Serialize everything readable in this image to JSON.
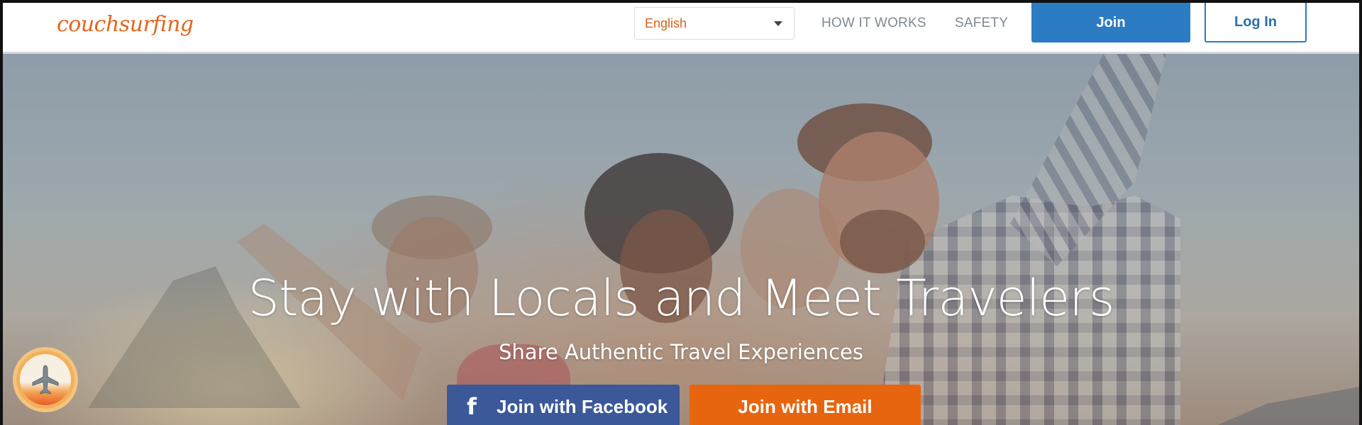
{
  "header": {
    "logo_text": "couchsurfing",
    "language": {
      "selected": "English"
    },
    "nav": [
      {
        "label": "HOW IT WORKS"
      },
      {
        "label": "SAFETY"
      }
    ],
    "join_label": "Join",
    "login_label": "Log In"
  },
  "hero": {
    "headline": "Stay with Locals and Meet Travelers",
    "subheadline": "Share Authentic Travel Experiences",
    "facebook_button": {
      "icon": "facebook-icon",
      "icon_glyph": "f",
      "label": "Join with Facebook"
    },
    "email_button": {
      "label": "Join with Email"
    },
    "badge_icon": "airplane-icon"
  },
  "colors": {
    "brand_orange": "#e5641a",
    "join_blue": "#2c7cc4",
    "facebook_blue": "#3b5998",
    "email_orange": "#e8650f",
    "nav_gray": "#7f8a93"
  }
}
